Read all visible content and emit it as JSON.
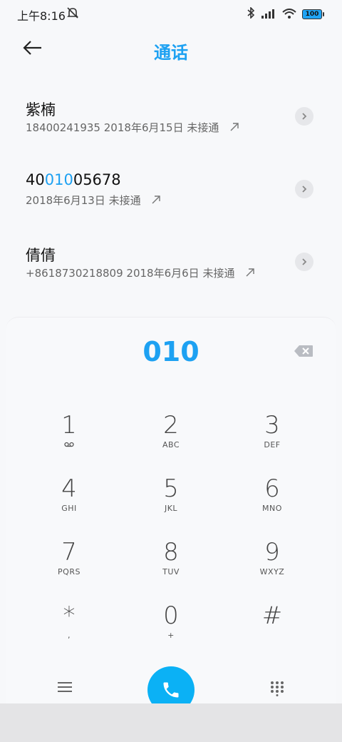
{
  "status_bar": {
    "time": "上午8:16",
    "battery": "100"
  },
  "header": {
    "title": "通话"
  },
  "calls": [
    {
      "name": "紫楠",
      "number": "18400241935",
      "date": "2018年6月15日",
      "status": "未接通"
    },
    {
      "name_prefix": "40",
      "name_match": "010",
      "name_suffix": "05678",
      "date": "2018年6月13日",
      "status": "未接通"
    },
    {
      "name": "倩倩",
      "number": "+8618730218809",
      "date": "2018年6月6日",
      "status": "未接通"
    }
  ],
  "dialpad": {
    "input": "010",
    "keys": [
      {
        "digit": "1",
        "letters": ""
      },
      {
        "digit": "2",
        "letters": "ABC"
      },
      {
        "digit": "3",
        "letters": "DEF"
      },
      {
        "digit": "4",
        "letters": "GHI"
      },
      {
        "digit": "5",
        "letters": "JKL"
      },
      {
        "digit": "6",
        "letters": "MNO"
      },
      {
        "digit": "7",
        "letters": "PQRS"
      },
      {
        "digit": "8",
        "letters": "TUV"
      },
      {
        "digit": "9",
        "letters": "WXYZ"
      },
      {
        "digit": "*",
        "letters": ","
      },
      {
        "digit": "0",
        "letters": "+"
      },
      {
        "digit": "#",
        "letters": ""
      }
    ]
  },
  "colors": {
    "accent": "#1da1f2",
    "call_button": "#0bb1f5"
  }
}
